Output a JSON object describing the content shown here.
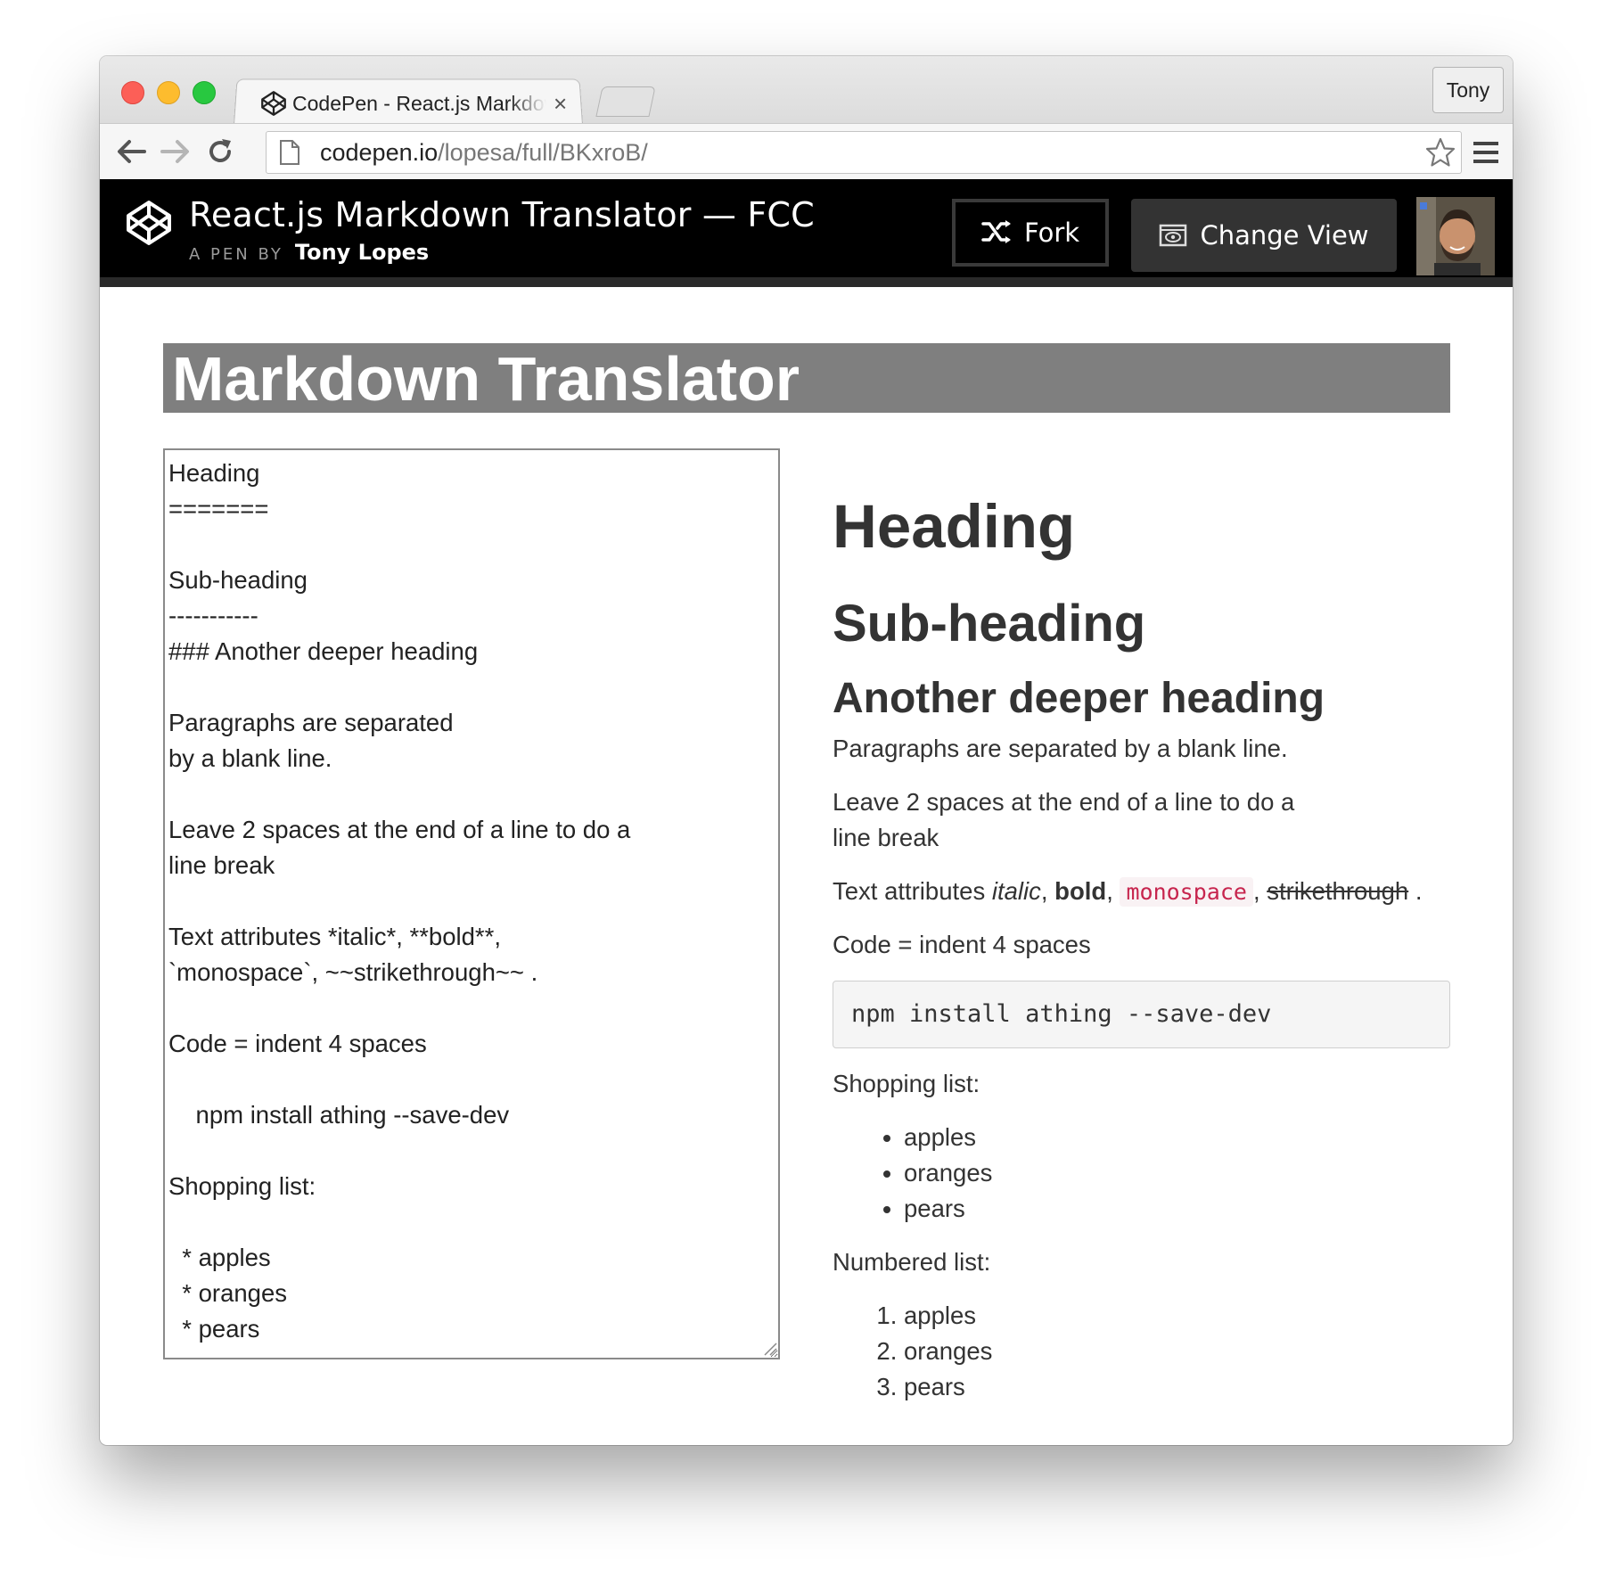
{
  "browser": {
    "tab_title": "CodePen - React.js Markdown Translator — FCC",
    "tab_close": "×",
    "profile_name": "Tony",
    "url_host": "codepen.io",
    "url_path": "/lopesa/full/BKxroB/"
  },
  "codepen": {
    "pen_title": "React.js Markdown Translator — FCC",
    "by_prefix": "A PEN BY",
    "author": "Tony Lopes",
    "fork_label": "Fork",
    "change_view_label": "Change View"
  },
  "page": {
    "banner": "Markdown Translator",
    "editor_text": "Heading\n=======\n\nSub-heading\n-----------\n### Another deeper heading\n\nParagraphs are separated\nby a blank line.\n\nLeave 2 spaces at the end of a line to do a\nline break\n\nText attributes *italic*, **bold**,\n`monospace`, ~~strikethrough~~ .\n\nCode = indent 4 spaces\n\n    npm install athing --save-dev\n\nShopping list:\n\n  * apples\n  * oranges\n  * pears"
  },
  "preview": {
    "h1": "Heading",
    "h2": "Sub-heading",
    "h3": "Another deeper heading",
    "paragraph": "Paragraphs are separated by a blank line.",
    "linebreak_line1": "Leave 2 spaces at the end of a line to do a",
    "linebreak_line2": "line break",
    "attrs_prefix": "Text attributes ",
    "attrs_italic": "italic",
    "attrs_sep1": ", ",
    "attrs_bold": "bold",
    "attrs_sep2": ", ",
    "attrs_mono": "monospace",
    "attrs_sep3": ", ",
    "attrs_strike": "strikethrough",
    "attrs_end": " .",
    "code_intro": "Code = indent 4 spaces",
    "code_block": "npm install athing --save-dev",
    "shopping_label": "Shopping list:",
    "shopping_items": [
      "apples",
      "oranges",
      "pears"
    ],
    "numbered_label": "Numbered list:",
    "numbered_items": [
      "apples",
      "oranges",
      "pears"
    ]
  },
  "colors": {
    "banner_bg": "#7f7f7f",
    "header_bg": "#000000",
    "inline_code": "#c7254e"
  }
}
